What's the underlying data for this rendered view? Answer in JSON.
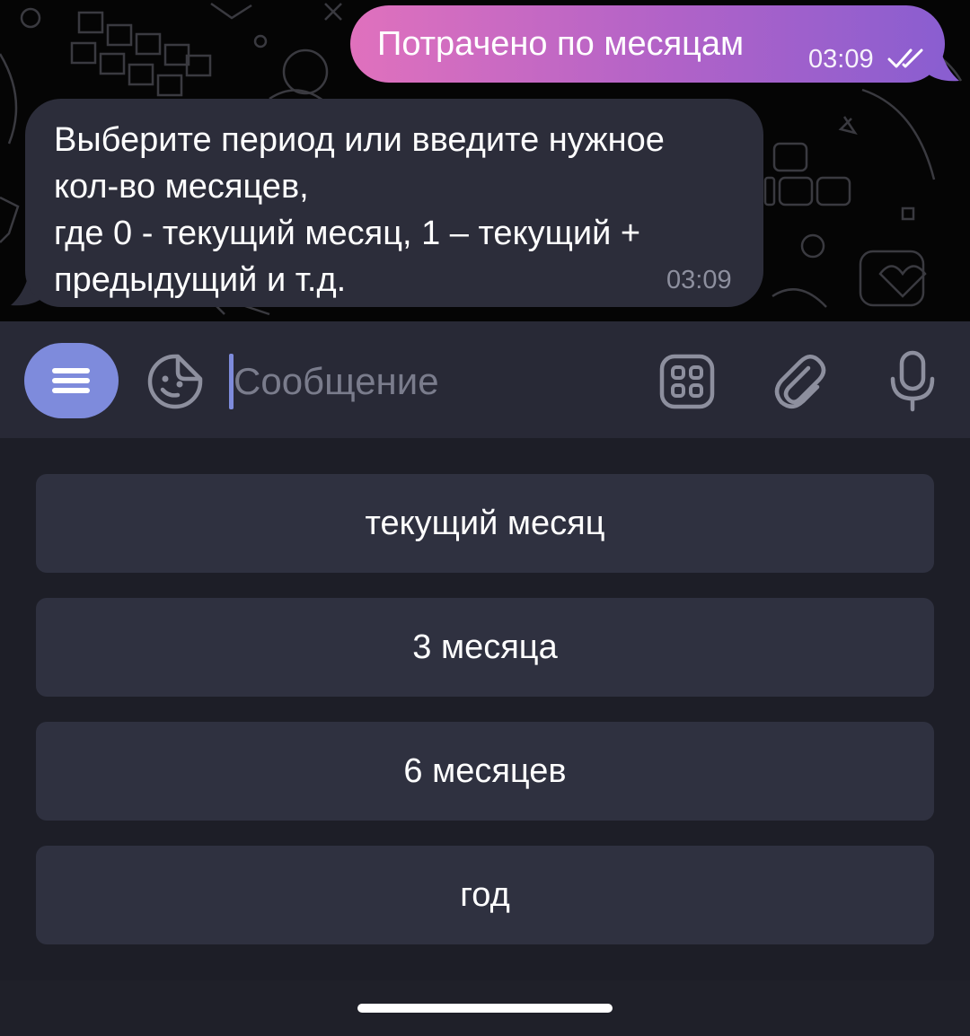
{
  "messages": {
    "outgoing": {
      "text": "Потрачено по месяцам",
      "time": "03:09",
      "status_icon": "double-check-icon"
    },
    "incoming": {
      "lines": [
        "Выберите период или введите нужное",
        "кол-во месяцев,",
        "где 0 - текущий месяц, 1 – текущий +",
        "предыдущий и т.д."
      ],
      "time": "03:09"
    }
  },
  "input_bar": {
    "menu_icon": "menu-lines-icon",
    "sticker_icon": "sticker-icon",
    "placeholder": "Сообщение",
    "keyboard_icon": "bot-keyboard-icon",
    "attach_icon": "paperclip-icon",
    "mic_icon": "microphone-icon"
  },
  "keyboard": {
    "buttons": [
      {
        "label": "текущий месяц"
      },
      {
        "label": "3 месяца"
      },
      {
        "label": "6 месяцев"
      },
      {
        "label": "год"
      }
    ]
  },
  "colors": {
    "accent": "#7e8bdc",
    "outgoing_gradient_start": "#e071bd",
    "outgoing_gradient_end": "#8a5ed0",
    "incoming_bubble": "#2c2d3a",
    "keyboard_button": "#2f3140"
  }
}
